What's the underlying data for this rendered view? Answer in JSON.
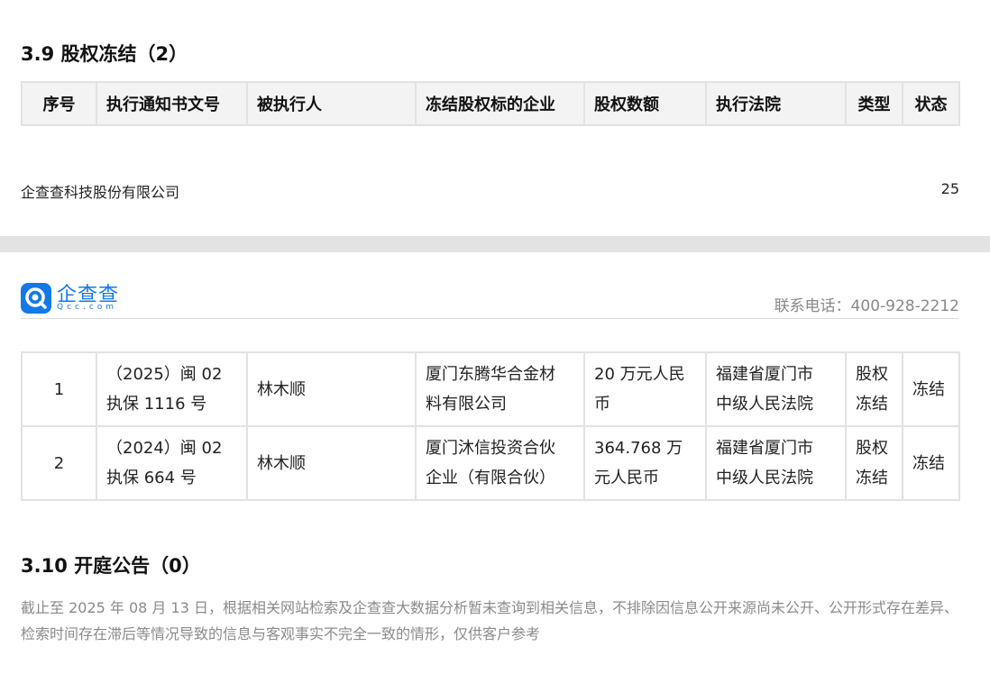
{
  "section_39": {
    "title": "3.9  股权冻结（2）",
    "columns": [
      "序号",
      "执行通知书文号",
      "被执行人",
      "冻结股权标的企业",
      "股权数额",
      "执行法院",
      "类型",
      "状态"
    ]
  },
  "page_footer": {
    "company": "企查查科技股份有限公司",
    "page_number": "25"
  },
  "page_header": {
    "logo_text": "企查查",
    "logo_sub": "Qcc.com",
    "hotline": "联系电话：400-928-2212",
    "logo_color": "#1479e6"
  },
  "rows": [
    {
      "index": "1",
      "doc_no_line1": "（2025）闽 02",
      "doc_no_line2": "执保 1116 号",
      "executee": "林木顺",
      "target_line1": "厦门东腾华合金材",
      "target_line2": "料有限公司",
      "amount_line1": "20 万元人民",
      "amount_line2": "币",
      "court_line1": "福建省厦门市",
      "court_line2": "中级人民法院",
      "type_line1": "股权",
      "type_line2": "冻结",
      "status": "冻结"
    },
    {
      "index": "2",
      "doc_no_line1": "（2024）闽 02",
      "doc_no_line2": "执保 664 号",
      "executee": "林木顺",
      "target_line1": "厦门沐信投资合伙",
      "target_line2": "企业（有限合伙）",
      "amount_line1": "364.768 万",
      "amount_line2": "元人民币",
      "court_line1": "福建省厦门市",
      "court_line2": "中级人民法院",
      "type_line1": "股权",
      "type_line2": "冻结",
      "status": "冻结"
    }
  ],
  "section_310": {
    "title": "3.10  开庭公告（0）",
    "note": "截止至 2025 年 08 月 13 日，根据相关网站检索及企查查大数据分析暂未查询到相关信息，不排除因信息公开来源尚未公开、公开形式存在差异、检索时间存在滞后等情况导致的信息与客观事实不完全一致的情形，仅供客户参考"
  }
}
